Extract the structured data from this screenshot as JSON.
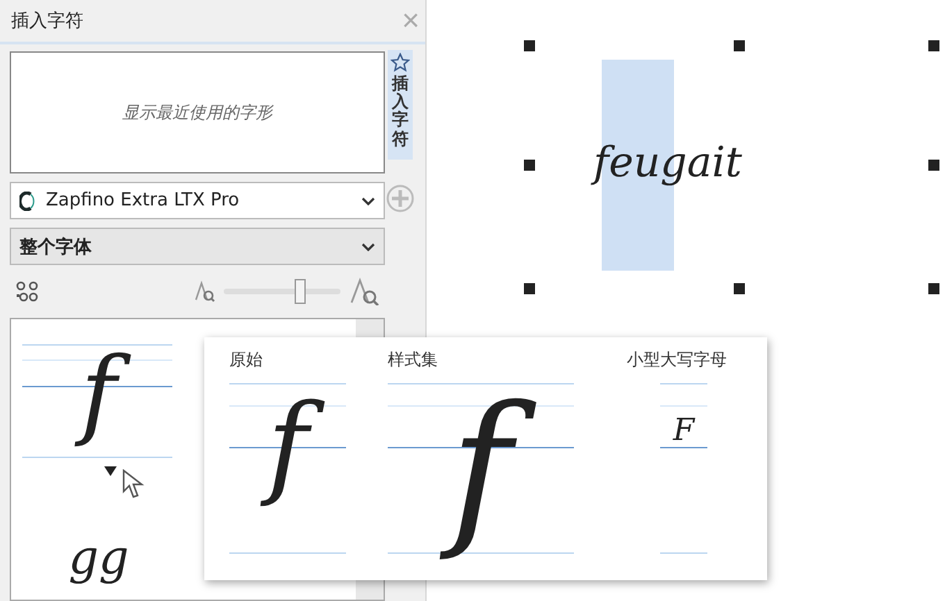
{
  "panel": {
    "title": "插入字符",
    "close": "×"
  },
  "recent": {
    "placeholder": "显示最近使用的字形"
  },
  "font_select": {
    "value": "Zapfino Extra LTX Pro"
  },
  "subset_select": {
    "value": "整个字体"
  },
  "zoom_slider": {
    "level": 0.65
  },
  "glyphs": [
    {
      "char": "f",
      "has_variants": true
    },
    {
      "char": "gg",
      "has_variants": false
    }
  ],
  "variants_popup": {
    "columns": [
      {
        "label": "原始",
        "char": "f",
        "kind": "standard"
      },
      {
        "label": "样式集",
        "char": "f",
        "kind": "swash"
      },
      {
        "label": "小型大写字母",
        "char": "F",
        "kind": "small-caps"
      }
    ]
  },
  "side_tabs": [
    {
      "label": "插入字符",
      "selected": true
    }
  ],
  "canvas": {
    "text": "feugait",
    "selected": true
  }
}
